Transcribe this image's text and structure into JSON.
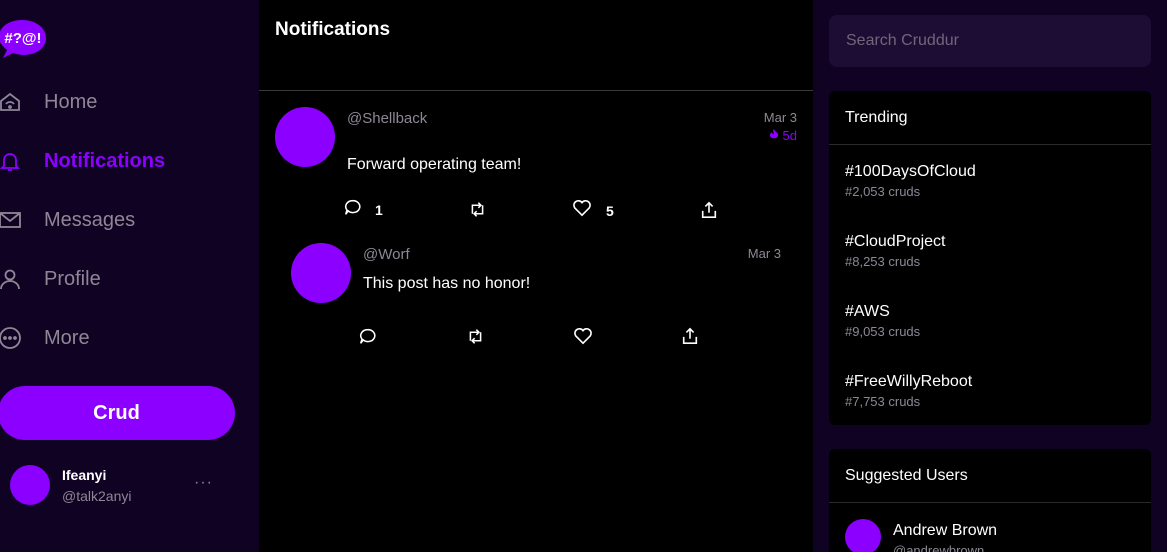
{
  "app": {
    "logo_text": "#?@!",
    "brand_color": "#8b00ff"
  },
  "nav": {
    "items": [
      {
        "label": "Home",
        "icon": "home-icon"
      },
      {
        "label": "Notifications",
        "icon": "bell-icon",
        "active": true
      },
      {
        "label": "Messages",
        "icon": "mail-icon"
      },
      {
        "label": "Profile",
        "icon": "person-icon"
      },
      {
        "label": "More",
        "icon": "more-circle-icon"
      }
    ],
    "crud_button": "Crud"
  },
  "profile": {
    "name": "Ifeanyi",
    "handle": "@talk2anyi",
    "menu": "···"
  },
  "main": {
    "title": "Notifications",
    "posts": [
      {
        "handle": "@Shellback",
        "date": "Mar 3",
        "expires": "5d",
        "content": "Forward operating team!",
        "replies": "1",
        "likes": "5"
      },
      {
        "handle": "@Worf",
        "date": "Mar 3",
        "content": "This post has no honor!"
      }
    ]
  },
  "search": {
    "placeholder": "Search Cruddur"
  },
  "trending": {
    "title": "Trending",
    "items": [
      {
        "tag": "#100DaysOfCloud",
        "count": "#2,053 cruds"
      },
      {
        "tag": "#CloudProject",
        "count": "#8,253 cruds"
      },
      {
        "tag": "#AWS",
        "count": "#9,053 cruds"
      },
      {
        "tag": "#FreeWillyReboot",
        "count": "#7,753 cruds"
      }
    ]
  },
  "suggested": {
    "title": "Suggested Users",
    "users": [
      {
        "name": "Andrew Brown",
        "handle": "@andrewbrown"
      }
    ]
  }
}
